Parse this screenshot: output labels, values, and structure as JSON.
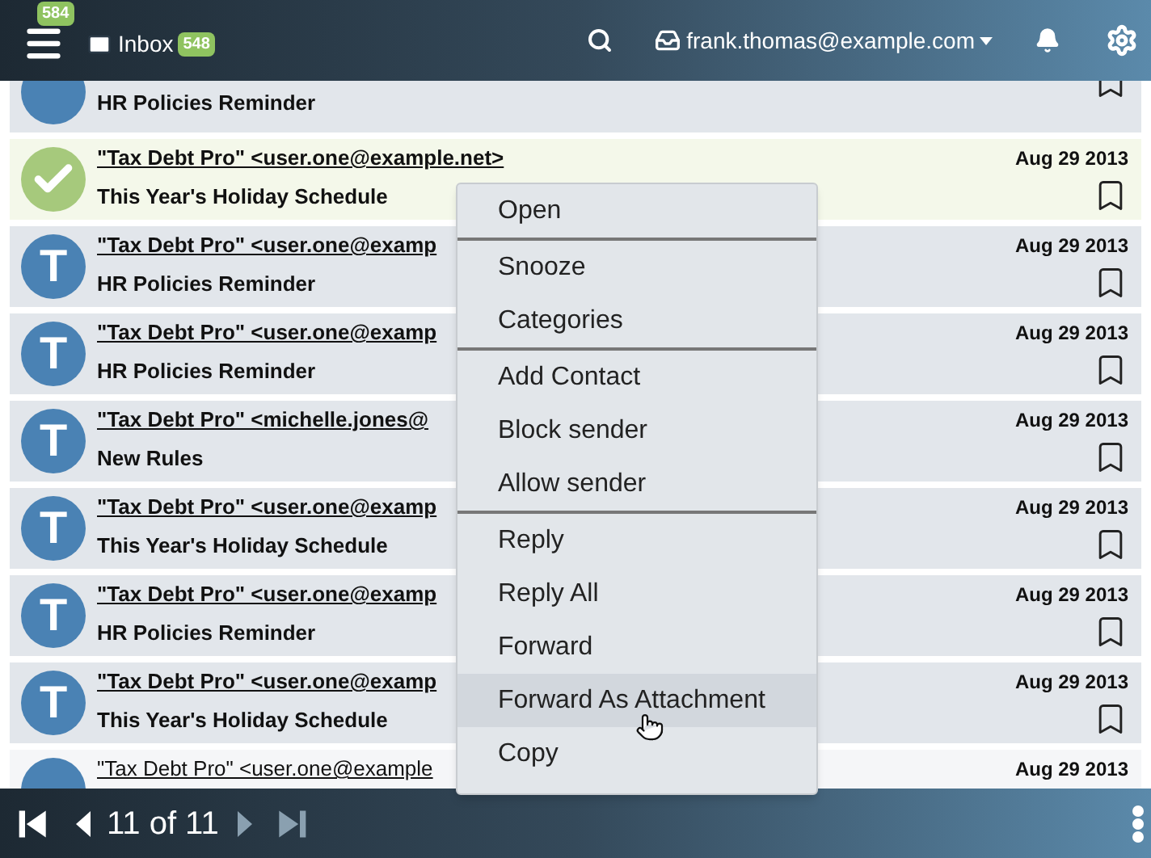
{
  "header": {
    "menu_badge": "584",
    "inbox_label": "Inbox",
    "inbox_badge": "548",
    "account": "frank.thomas@example.com"
  },
  "messages": [
    {
      "subject": "HR Policies Reminder",
      "unread": true,
      "selected": false
    },
    {
      "sender": "\"Tax Debt Pro\" <user.one@example.net>",
      "subject": "This Year's Holiday Schedule",
      "date": "Aug 29 2013",
      "unread": true,
      "selected": true
    },
    {
      "avatar_letter": "T",
      "sender": "\"Tax Debt Pro\" <user.one@examp",
      "subject": "HR Policies Reminder",
      "date": "Aug 29 2013",
      "unread": true,
      "selected": false
    },
    {
      "avatar_letter": "T",
      "sender": "\"Tax Debt Pro\" <user.one@examp",
      "subject": "HR Policies Reminder",
      "date": "Aug 29 2013",
      "unread": true,
      "selected": false
    },
    {
      "avatar_letter": "T",
      "sender": "\"Tax Debt Pro\" <michelle.jones@",
      "subject": "New Rules",
      "date": "Aug 29 2013",
      "unread": true,
      "selected": false
    },
    {
      "avatar_letter": "T",
      "sender": "\"Tax Debt Pro\" <user.one@examp",
      "subject": "This Year's Holiday Schedule",
      "date": "Aug 29 2013",
      "unread": true,
      "selected": false
    },
    {
      "avatar_letter": "T",
      "sender": "\"Tax Debt Pro\" <user.one@examp",
      "subject": "HR Policies Reminder",
      "date": "Aug 29 2013",
      "unread": true,
      "selected": false
    },
    {
      "avatar_letter": "T",
      "sender": "\"Tax Debt Pro\" <user.one@examp",
      "subject": "This Year's Holiday Schedule",
      "date": "Aug 29 2013",
      "unread": true,
      "selected": false
    },
    {
      "sender": "\"Tax Debt Pro\" <user.one@example",
      "date": "Aug 29 2013",
      "unread": false,
      "selected": false
    }
  ],
  "context_menu": [
    {
      "label": "Open",
      "separator_after": true,
      "selected": false
    },
    {
      "label": "Snooze",
      "separator_after": false,
      "selected": false
    },
    {
      "label": "Categories",
      "separator_after": true,
      "selected": false
    },
    {
      "label": "Add Contact",
      "separator_after": false,
      "selected": false
    },
    {
      "label": "Block sender",
      "separator_after": false,
      "selected": false
    },
    {
      "label": "Allow sender",
      "separator_after": true,
      "selected": false
    },
    {
      "label": "Reply",
      "separator_after": false,
      "selected": false
    },
    {
      "label": "Reply All",
      "separator_after": false,
      "selected": false
    },
    {
      "label": "Forward",
      "separator_after": false,
      "selected": false
    },
    {
      "label": "Forward As Attachment",
      "separator_after": false,
      "selected": true
    },
    {
      "label": "Copy",
      "separator_after": false,
      "selected": false
    }
  ],
  "pager": {
    "text": "11 of 11",
    "first_disabled": false,
    "prev_disabled": false,
    "next_disabled": true,
    "last_disabled": true
  }
}
